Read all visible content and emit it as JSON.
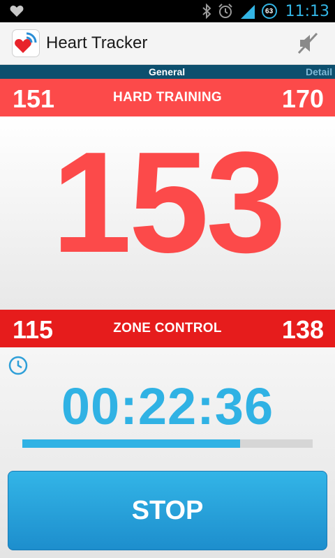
{
  "status_bar": {
    "time": "11:13",
    "battery_level": "63",
    "icons": [
      "heart-notification-icon",
      "bluetooth-icon",
      "alarm-icon",
      "signal-icon",
      "battery-icon"
    ]
  },
  "action_bar": {
    "title": "Heart Tracker",
    "icon": "heart-tracker-app-icon",
    "action_icon": "mute-speaker-icon"
  },
  "tabs": [
    {
      "label": "General",
      "active": true
    },
    {
      "label": "Detail",
      "active": false
    }
  ],
  "upper_zone": {
    "min": "151",
    "label": "HARD TRAINING",
    "max": "170"
  },
  "heart_rate": "153",
  "lower_zone": {
    "min": "115",
    "label": "ZONE CONTROL",
    "max": "138"
  },
  "timer": {
    "elapsed": "00:22:36",
    "progress_percent": 75
  },
  "stop_button": {
    "label": "STOP"
  },
  "colors": {
    "accent_blue": "#30b2e4",
    "heart_red": "#fc4a4a",
    "zone_dark_red": "#e61c1c",
    "tab_bar": "#0d4f6e"
  }
}
